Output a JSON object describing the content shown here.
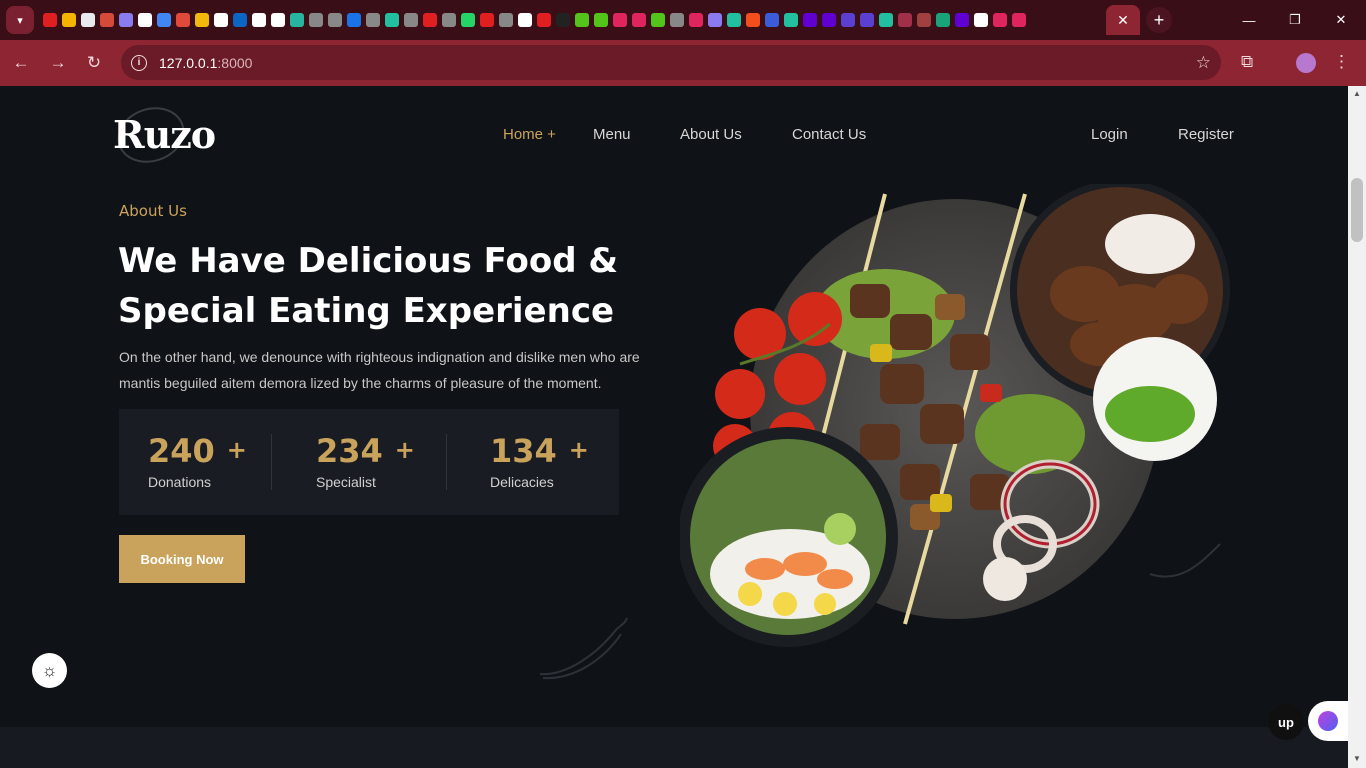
{
  "browser": {
    "url_host": "127.0.0.1",
    "url_port": ":8000",
    "active_tab_close": "✕",
    "new_tab": "+"
  },
  "site": {
    "logo": "Ruzo",
    "nav": {
      "home": "Home +",
      "menu": "Menu",
      "about": "About Us",
      "contact": "Contact Us",
      "login": "Login",
      "register": "Register"
    },
    "hero": {
      "eyebrow": "About Us",
      "title_line1": "We Have Delicious Food &",
      "title_line2": "Special Eating Experience",
      "description": "On the other hand, we denounce with righteous indignation and dislike men who are mantis beguiled aitem demora lized by the charms of pleasure of the moment.",
      "stats": [
        {
          "value": "240",
          "suffix": "+",
          "label": "Donations"
        },
        {
          "value": "234",
          "suffix": "+",
          "label": "Specialist"
        },
        {
          "value": "134",
          "suffix": "+",
          "label": "Delicacies"
        }
      ],
      "cta": "Booking Now"
    },
    "widgets": {
      "up_label": "up"
    }
  },
  "colors": {
    "accent": "#c9a35c",
    "page_bg": "#0f1216",
    "chrome": "#8e2533"
  },
  "icons": {
    "theme_toggle": "sun-icon",
    "back": "arrow-left-icon",
    "forward": "arrow-right-icon",
    "reload": "reload-icon",
    "bookmark": "star-icon"
  }
}
